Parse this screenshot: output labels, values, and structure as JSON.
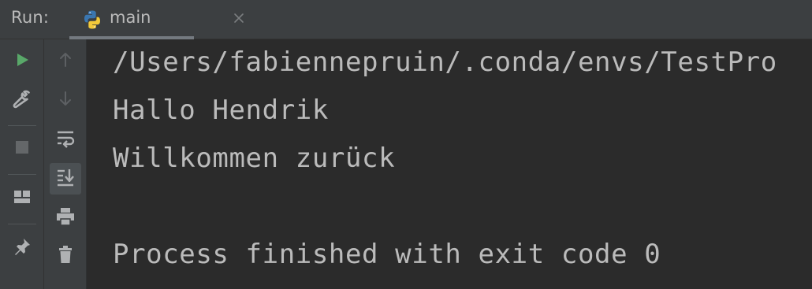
{
  "header": {
    "run_label": "Run:",
    "tab": {
      "label": "main",
      "icon": "python-icon",
      "close_icon": "close-icon"
    }
  },
  "toolbar_left": [
    {
      "name": "rerun-icon",
      "color": "#59a869"
    },
    {
      "name": "wrench-icon"
    },
    {
      "name": "stop-icon"
    },
    {
      "name": "layout-icon"
    },
    {
      "name": "pin-icon"
    }
  ],
  "toolbar_right": [
    {
      "name": "scroll-up-icon"
    },
    {
      "name": "scroll-down-icon"
    },
    {
      "name": "soft-wrap-icon"
    },
    {
      "name": "scroll-to-end-icon",
      "active": true
    },
    {
      "name": "print-icon"
    },
    {
      "name": "trash-icon"
    }
  ],
  "console": {
    "lines": [
      "/Users/fabiennepruin/.conda/envs/TestPro",
      "Hallo Hendrik",
      "Willkommen zurück",
      "",
      "Process finished with exit code 0"
    ]
  },
  "colors": {
    "background": "#2b2b2b",
    "panel": "#3c3f41",
    "text": "#bbbbbb",
    "run_green": "#59a869",
    "icon_gray": "#afb1b3"
  }
}
